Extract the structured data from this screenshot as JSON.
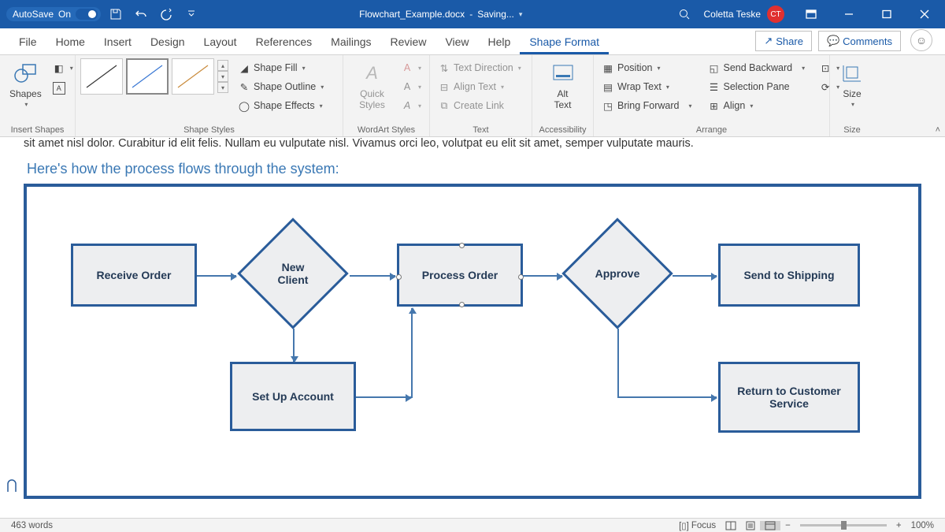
{
  "titlebar": {
    "autosave_label": "AutoSave",
    "autosave_state": "On",
    "doc_title": "Flowchart_Example.docx",
    "status": "Saving...",
    "user_name": "Coletta Teske",
    "user_initials": "CT"
  },
  "menu": {
    "file": "File",
    "home": "Home",
    "insert": "Insert",
    "design": "Design",
    "layout": "Layout",
    "references": "References",
    "mailings": "Mailings",
    "review": "Review",
    "view": "View",
    "help": "Help",
    "shape_format": "Shape Format",
    "share": "Share",
    "comments": "Comments"
  },
  "ribbon": {
    "groups": {
      "insert_shapes": "Insert Shapes",
      "shape_styles": "Shape Styles",
      "wordart_styles": "WordArt Styles",
      "text": "Text",
      "accessibility": "Accessibility",
      "arrange": "Arrange",
      "size": "Size"
    },
    "shapes": "Shapes",
    "shape_fill": "Shape Fill",
    "shape_outline": "Shape Outline",
    "shape_effects": "Shape Effects",
    "quick_styles": "Quick Styles",
    "text_direction": "Text Direction",
    "align_text": "Align Text",
    "create_link": "Create Link",
    "alt_text": "Alt Text",
    "position": "Position",
    "wrap_text": "Wrap Text",
    "bring_forward": "Bring Forward",
    "send_backward": "Send Backward",
    "selection_pane": "Selection Pane",
    "align": "Align",
    "size_btn": "Size"
  },
  "document": {
    "trunc_line": "sit amet nisl dolor. Curabitur id elit felis. Nullam eu vulputate nisl. Vivamus orci leo, volutpat eu elit sit amet, semper vulputate mauris.",
    "caption": "Here's how the process flows through the system:",
    "flow": {
      "receive_order": "Receive Order",
      "new_client": "New\nClient",
      "process_order": "Process Order",
      "approve": "Approve",
      "send_shipping": "Send to Shipping",
      "set_up_account": "Set Up Account",
      "return_cs": "Return to Customer Service"
    }
  },
  "statusbar": {
    "word_count": "463 words",
    "focus": "Focus",
    "zoom": "100%"
  }
}
